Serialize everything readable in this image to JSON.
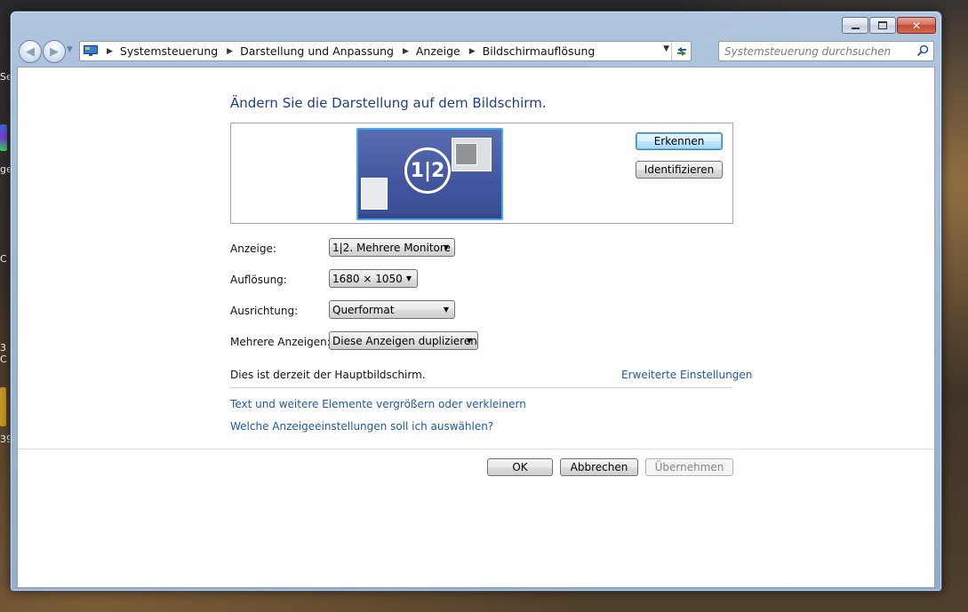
{
  "window": {
    "controls": {
      "minimize": "▭",
      "maximize": "▣",
      "close": "✕"
    }
  },
  "navigation": {
    "back_icon": "back-arrow-icon",
    "forward_icon": "forward-arrow-icon",
    "breadcrumbs": [
      "Systemsteuerung",
      "Darstellung und Anpassung",
      "Anzeige",
      "Bildschirmauflösung"
    ],
    "search_placeholder": "Systemsteuerung durchsuchen"
  },
  "page": {
    "heading": "Ändern Sie die Darstellung auf dem Bildschirm.",
    "preview": {
      "monitor_label": "1|2"
    },
    "buttons": {
      "detect": "Erkennen",
      "identify": "Identifizieren"
    },
    "fields": {
      "display_label": "Anzeige:",
      "display_value": "1|2. Mehrere Monitore",
      "resolution_label": "Auflösung:",
      "resolution_value": "1680 × 1050",
      "orientation_label": "Ausrichtung:",
      "orientation_value": "Querformat",
      "multiple_label": "Mehrere Anzeigen:",
      "multiple_value": "Diese Anzeigen duplizieren"
    },
    "status_text": "Dies ist derzeit der Hauptbildschirm.",
    "advanced_link": "Erweiterte Einstellungen",
    "links": [
      "Text und weitere Elemente vergrößern oder verkleinern",
      "Welche Anzeigeeinstellungen soll ich auswählen?"
    ],
    "footer": {
      "ok": "OK",
      "cancel": "Abbrechen",
      "apply": "Übernehmen"
    }
  },
  "colors": {
    "link": "#1d5aab",
    "heading": "#1e3f86",
    "monitor_border": "#44aaf0",
    "monitor_fill": "#4256a0"
  }
}
